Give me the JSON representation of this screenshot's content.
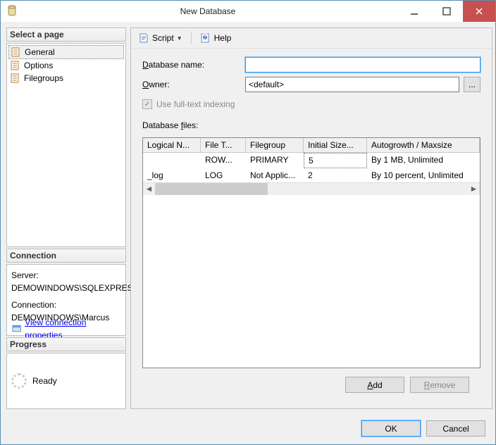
{
  "titlebar": {
    "title": "New Database"
  },
  "sidebar": {
    "select_page_header": "Select a page",
    "pages": [
      {
        "label": "General",
        "selected": true
      },
      {
        "label": "Options",
        "selected": false
      },
      {
        "label": "Filegroups",
        "selected": false
      }
    ],
    "connection_header": "Connection",
    "server_label": "Server:",
    "server_value": "DEMOWINDOWS\\SQLEXPRESS",
    "connection_label": "Connection:",
    "connection_value": "DEMOWINDOWS\\Marcus",
    "view_conn_props": "View connection properties",
    "progress_header": "Progress",
    "progress_status": "Ready"
  },
  "toolbar": {
    "script": "Script",
    "help": "Help"
  },
  "form": {
    "dbname_label": "Database name:",
    "dbname_value": "",
    "owner_label": "Owner:",
    "owner_value": "<default>",
    "fulltext_label": "Use full-text indexing",
    "files_label": "Database files:"
  },
  "grid": {
    "headers": [
      "Logical N...",
      "File T...",
      "Filegroup",
      "Initial Size...",
      "Autogrowth / Maxsize"
    ],
    "rows": [
      {
        "logical": "",
        "filetype": "ROW...",
        "filegroup": "PRIMARY",
        "initsize": "5",
        "autogrow": "By 1 MB, Unlimited",
        "initsel": true
      },
      {
        "logical": "_log",
        "filetype": "LOG",
        "filegroup": "Not Applic...",
        "initsize": "2",
        "autogrow": "By 10 percent, Unlimited",
        "initsel": false
      }
    ]
  },
  "buttons": {
    "add": "Add",
    "remove": "Remove",
    "ok": "OK",
    "cancel": "Cancel"
  }
}
